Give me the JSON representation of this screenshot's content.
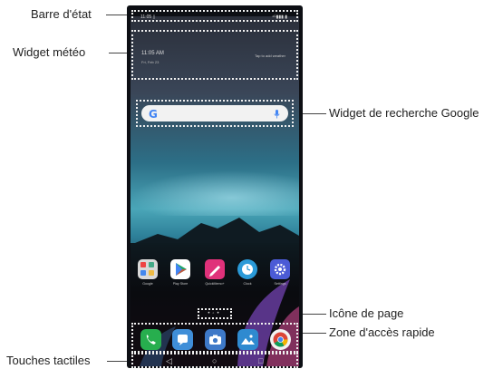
{
  "callouts": {
    "status_bar": "Barre d'état",
    "weather_widget": "Widget météo",
    "search_widget": "Widget de recherche Google",
    "page_icon": "Icône de page",
    "quick_access": "Zone d'accès rapide",
    "touch_keys": "Touches tactiles"
  },
  "status_bar": {
    "time": "11:05 ▯",
    "right": "⁴ᴳ▮▮▮ ▮"
  },
  "weather": {
    "time": "11:05 AM",
    "date": "Fri, Feb 23",
    "hint": "Tap to add weather"
  },
  "search": {
    "logo": "G"
  },
  "apps": [
    {
      "name": "Google",
      "color": "#cfcfcf"
    },
    {
      "name": "Play Store",
      "color": "#ffffff"
    },
    {
      "name": "QuickMemo+",
      "color": "#e0317a"
    },
    {
      "name": "Clock",
      "color": "#2a9ad8"
    },
    {
      "name": "Settings",
      "color": "#4b5bd6"
    }
  ],
  "page_indicator": "•◦•",
  "dock": [
    {
      "name": "phone",
      "color": "#27ae4e"
    },
    {
      "name": "messages",
      "color": "#3f8ed8"
    },
    {
      "name": "camera",
      "color": "#3e79c8"
    },
    {
      "name": "gallery",
      "color": "#2f8ad0"
    },
    {
      "name": "chrome",
      "color": "#f2f2f2"
    }
  ],
  "nav": {
    "back": "◁",
    "home": "○",
    "recents": "□"
  }
}
